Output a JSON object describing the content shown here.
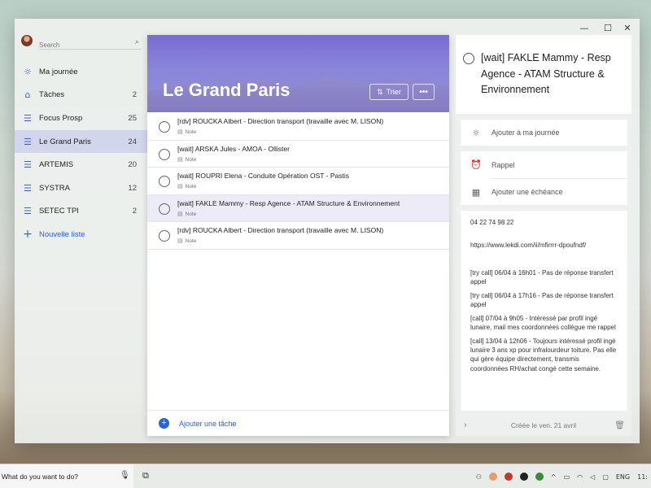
{
  "window": {
    "min": "—",
    "max": "☐",
    "close": "✕"
  },
  "search": {
    "placeholder": "Search",
    "icon": "⌕"
  },
  "sidebar": {
    "items": [
      {
        "icon": "☼",
        "label": "Ma journée",
        "count": ""
      },
      {
        "icon": "⌂",
        "label": "Tâches",
        "count": "2"
      },
      {
        "icon": "☰",
        "label": "Focus Prosp",
        "count": "25"
      },
      {
        "icon": "☰",
        "label": "Le Grand Paris",
        "count": "24"
      },
      {
        "icon": "☰",
        "label": "ARTEMIS",
        "count": "20"
      },
      {
        "icon": "☰",
        "label": "SYSTRA",
        "count": "12"
      },
      {
        "icon": "☰",
        "label": "SETEC TPI",
        "count": "2"
      }
    ],
    "new_list": {
      "icon": "+",
      "label": "Nouvelle liste"
    }
  },
  "list": {
    "title": "Le Grand Paris",
    "sort_label": "Trier",
    "sort_icon": "⇅",
    "more_icon": "•••",
    "tasks": [
      {
        "title": "[rdv] ROUCKA Albert - Direction transport (travaille avec M. LISON)",
        "note": "Note"
      },
      {
        "title": "[wait] ARSKA Jules - AMOA - Ollister",
        "note": "Note"
      },
      {
        "title": "[wait] ROUPRI Elena - Conduite Opération OST - Pastis",
        "note": "Note"
      },
      {
        "title": "[wait] FAKLE Mammy - Resp Agence - ATAM Structure & Environnement",
        "note": "Note"
      },
      {
        "title": "[rdv] ROUCKA Albert - Direction transport (travaille avec M. LISON)",
        "note": "Note"
      }
    ],
    "add_task": "Ajouter une tâche"
  },
  "detail": {
    "title": "[wait] FAKLE Mammy - Resp Agence - ATAM Structure & Environnement",
    "add_day": "Ajouter à ma journée",
    "reminder": "Rappel",
    "due": "Ajouter une échéance",
    "notes": [
      "04 22 74 98 22",
      "https://www.lekdi.com/ii/mfirrrr-dpoufndf/",
      "[try call] 06/04 à 16h01 - Pas de réponse transfert appel",
      "[try call] 06/04 à 17h16 - Pas de réponse transfert appel",
      "[call] 07/04 à 9h05 - Intéressé par profil ingé lunaire, mail mes coordonnées collègue me rappel",
      "[call] 13/04 à 12h06 - Toujours intéressé profil ingé lunaire 3 ans xp pour infralourdeur toiture. Pas elle qui gère équipe directement, transmis coordonnées RH/achat congé cette semaine."
    ],
    "created": "Créée le ven. 21 avril"
  },
  "taskbar": {
    "cortana": "What do you want to do?",
    "lang": "ENG",
    "clock": "11:"
  }
}
